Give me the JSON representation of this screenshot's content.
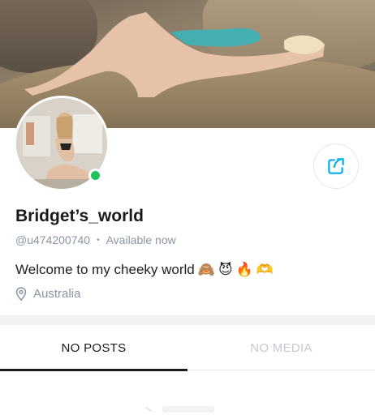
{
  "profile": {
    "name": "Bridget’s_world",
    "username": "@u474200740",
    "status": "Available now",
    "bio_text": "Welcome to my cheeky world",
    "bio_emojis": [
      "🙈",
      "😈",
      "🔥",
      "🫶"
    ],
    "location": "Australia",
    "online": true
  },
  "tabs": [
    {
      "label": "NO POSTS",
      "active": true
    },
    {
      "label": "NO MEDIA",
      "active": false
    }
  ],
  "icons": {
    "share": "share-icon",
    "location": "map-pin-icon"
  },
  "colors": {
    "accent": "#00aff0",
    "online": "#1fc35a",
    "muted": "#8a96a3"
  }
}
